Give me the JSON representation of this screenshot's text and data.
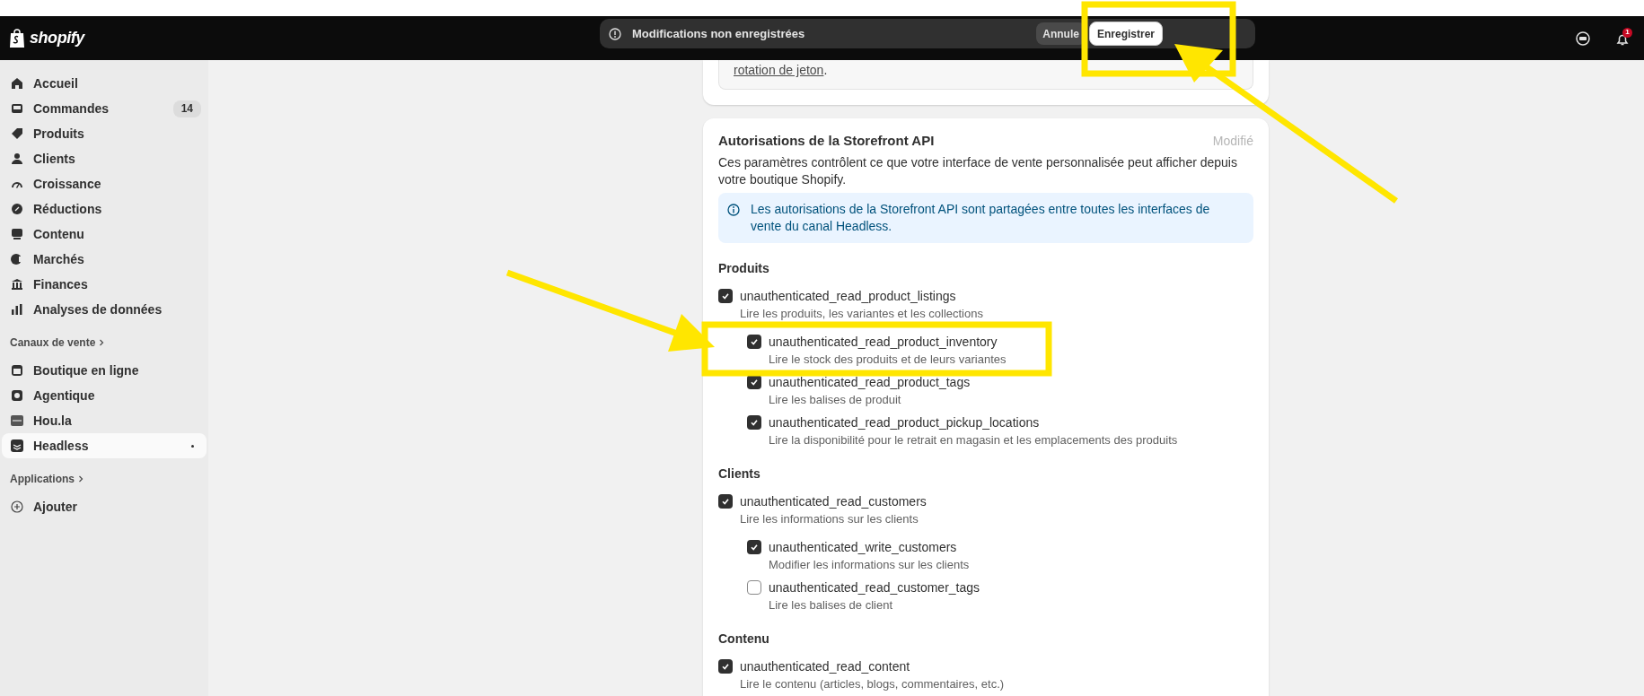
{
  "topbar": {
    "logo": "shopify",
    "save_bar": {
      "message": "Modifications non enregistrées",
      "buttons": [
        {
          "label": "Annule",
          "kind": "secondary"
        },
        {
          "label": "Enregistrer",
          "kind": "primary"
        }
      ]
    },
    "notifications": "1"
  },
  "sidebar": {
    "items": [
      {
        "label": "Accueil",
        "selected": false
      },
      {
        "label": "Commandes",
        "badge": "14",
        "selected": false
      },
      {
        "label": "Produits",
        "selected": false
      },
      {
        "label": "Clients",
        "selected": false
      },
      {
        "label": "Croissance",
        "selected": false
      },
      {
        "label": "Réductions",
        "selected": false
      },
      {
        "label": "Contenu",
        "selected": false
      },
      {
        "label": "Marchés",
        "selected": false
      },
      {
        "label": "Finances",
        "selected": false
      },
      {
        "label": "Analyses de données",
        "selected": false
      }
    ],
    "sections": [
      {
        "title": "Canaux de vente",
        "items": [
          {
            "label": "Boutique en ligne",
            "selected": false
          },
          {
            "label": "Agentique",
            "selected": false
          },
          {
            "label": "Hou.la",
            "selected": false
          },
          {
            "label": "Headless",
            "selected": true
          }
        ]
      },
      {
        "title": "Applications",
        "items": [
          {
            "label": "Ajouter",
            "selected": false
          }
        ]
      }
    ]
  },
  "previous_card": {
    "link": "rotation de jeton",
    "after": "."
  },
  "card": {
    "title": "Autorisations de la Storefront API",
    "status": "Modifié",
    "description": "Ces paramètres contrôlent ce que votre interface de vente personnalisée peut afficher depuis votre boutique Shopify.",
    "banner": "Les autorisations de la Storefront API sont partagées entre toutes les interfaces de vente du canal Headless.",
    "groups": [
      {
        "title": "Produits",
        "items": [
          {
            "name": "unauthenticated_read_product_listings",
            "description": "Lire les produits, les variantes et les collections",
            "checked": true,
            "children": [
              {
                "name": "unauthenticated_read_product_inventory",
                "description": "Lire le stock des produits et de leurs variantes",
                "checked": true
              },
              {
                "name": "unauthenticated_read_product_tags",
                "description": "Lire les balises de produit",
                "checked": true
              },
              {
                "name": "unauthenticated_read_product_pickup_locations",
                "description": "Lire la disponibilité pour le retrait en magasin et les emplacements des produits",
                "checked": true
              }
            ]
          }
        ]
      },
      {
        "title": "Clients",
        "items": [
          {
            "name": "unauthenticated_read_customers",
            "description": "Lire les informations sur les clients",
            "checked": true,
            "children": [
              {
                "name": "unauthenticated_write_customers",
                "description": "Modifier les informations sur les clients",
                "checked": true
              },
              {
                "name": "unauthenticated_read_customer_tags",
                "description": "Lire les balises de client",
                "checked": false
              }
            ]
          }
        ]
      },
      {
        "title": "Contenu",
        "items": [
          {
            "name": "unauthenticated_read_content",
            "description": "Lire le contenu (articles, blogs, commentaires, etc.)",
            "checked": true
          }
        ]
      }
    ]
  }
}
